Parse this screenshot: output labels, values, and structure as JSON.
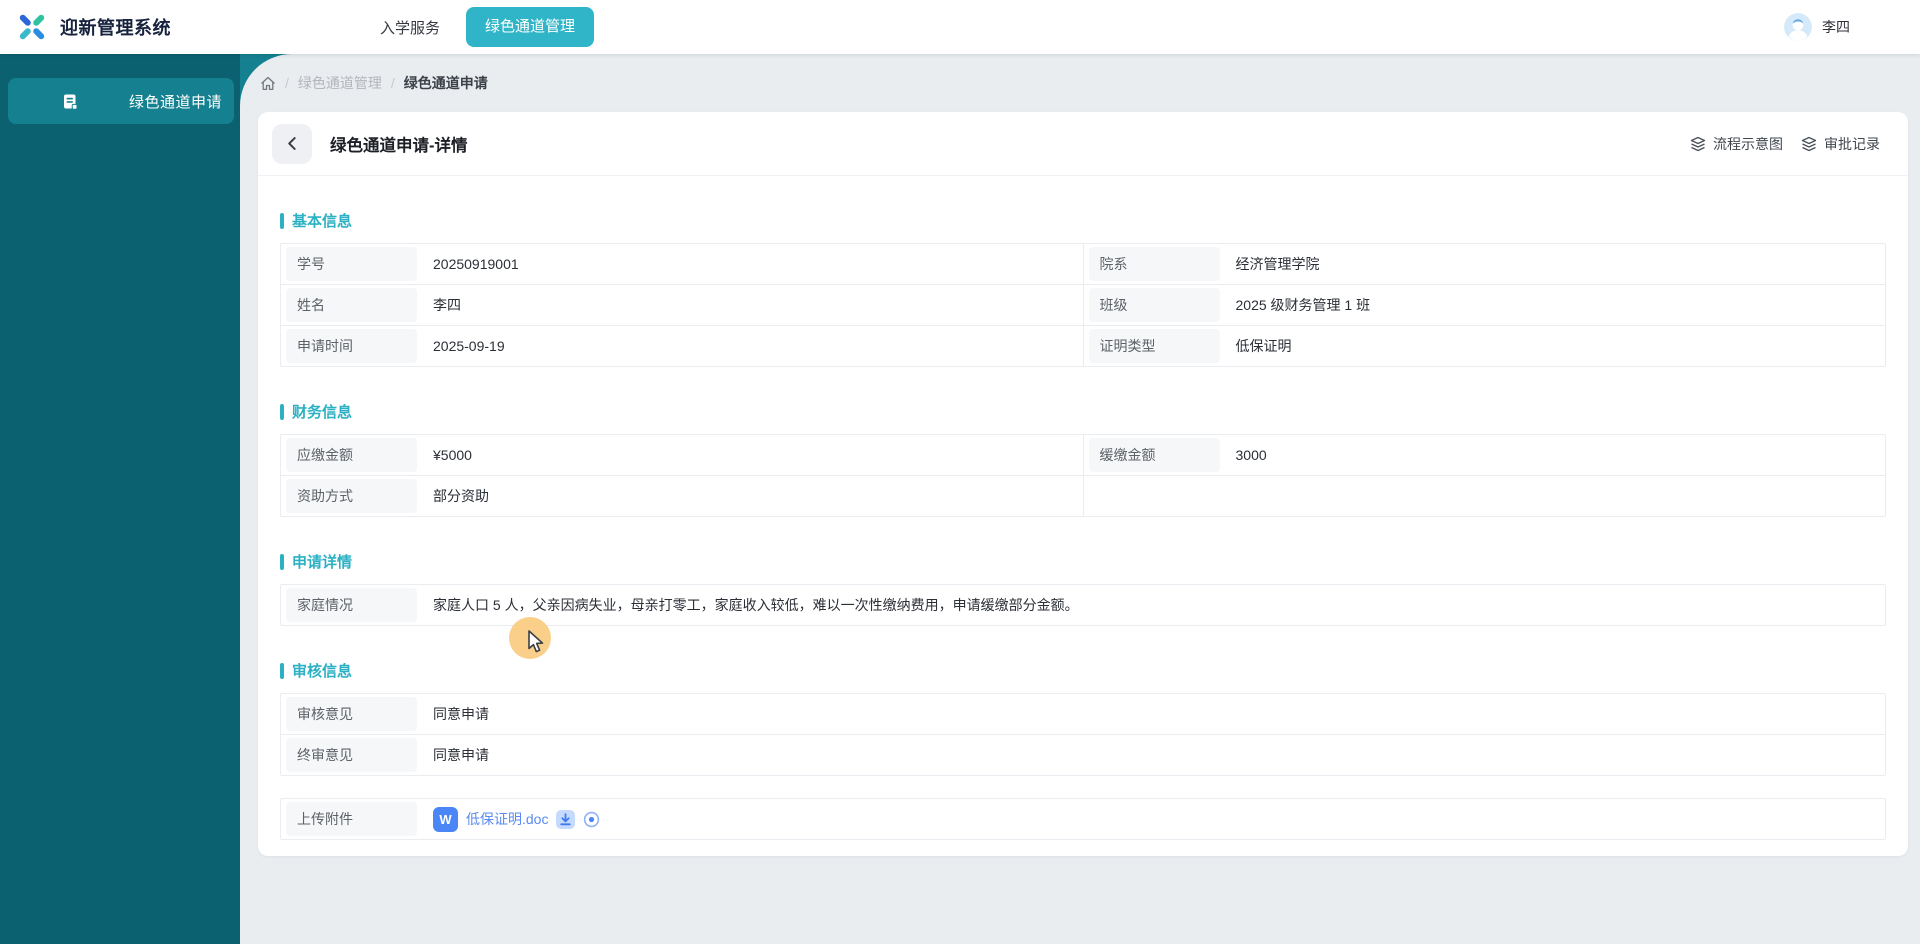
{
  "app": {
    "title": "迎新管理系统"
  },
  "navbar": {
    "items": [
      {
        "label": "入学服务",
        "active": false
      },
      {
        "label": "绿色通道管理",
        "active": true
      }
    ],
    "user": {
      "name": "李四",
      "avatar_icon": "user-avatar-icon"
    }
  },
  "sidebar": {
    "items": [
      {
        "label": "绿色通道申请",
        "icon": "form-icon",
        "active": true
      }
    ]
  },
  "breadcrumb": {
    "home_icon": "home-icon",
    "items": [
      "绿色通道管理",
      "绿色通道申请"
    ],
    "separator": "/"
  },
  "page": {
    "title": "绿色通道申请-详情",
    "back_icon": "chevron-left-icon",
    "actions": [
      {
        "label": "流程示意图",
        "icon": "layers-icon"
      },
      {
        "label": "审批记录",
        "icon": "layers-icon"
      }
    ]
  },
  "sections": [
    {
      "title": "基本信息",
      "layout": "two-col",
      "rows": [
        [
          {
            "label": "学号",
            "value": "20250919001"
          },
          {
            "label": "院系",
            "value": "经济管理学院"
          }
        ],
        [
          {
            "label": "姓名",
            "value": "李四"
          },
          {
            "label": "班级",
            "value": "2025 级财务管理 1 班"
          }
        ],
        [
          {
            "label": "申请时间",
            "value": "2025-09-19"
          },
          {
            "label": "证明类型",
            "value": "低保证明"
          }
        ]
      ]
    },
    {
      "title": "财务信息",
      "layout": "two-col",
      "rows": [
        [
          {
            "label": "应缴金额",
            "value": "¥5000"
          },
          {
            "label": "缓缴金额",
            "value": "3000"
          }
        ],
        [
          {
            "label": "资助方式",
            "value": "部分资助"
          },
          null
        ]
      ]
    },
    {
      "title": "申请详情",
      "layout": "one-col",
      "rows": [
        [
          {
            "label": "家庭情况",
            "value": "家庭人口 5 人，父亲因病失业，母亲打零工，家庭收入较低，难以一次性缴纳费用，申请缓缴部分金额。"
          }
        ]
      ]
    },
    {
      "title": "审核信息",
      "layout": "one-col",
      "rows": [
        [
          {
            "label": "审核意见",
            "value": "同意申请"
          }
        ],
        [
          {
            "label": "终审意见",
            "value": "同意申请"
          }
        ]
      ]
    }
  ],
  "attachment": {
    "label": "上传附件",
    "file_badge": "W",
    "file_badge_icon": "word-file-icon",
    "file_name": "低保证明.doc",
    "actions": [
      "download-icon",
      "preview-icon"
    ]
  },
  "theme": {
    "accent_cyan": "#2fb5c7",
    "sidebar_bg": "#0b6170",
    "sidebar_active_bg": "#15808f",
    "section_title_color": "#2cb1c4",
    "link_blue": "#5a8af2",
    "word_badge_blue": "#4a86f5",
    "cursor_halo": "#f8cb80",
    "label_cell_bg": "#f6f7f9",
    "content_bg": "#e9edf0"
  }
}
